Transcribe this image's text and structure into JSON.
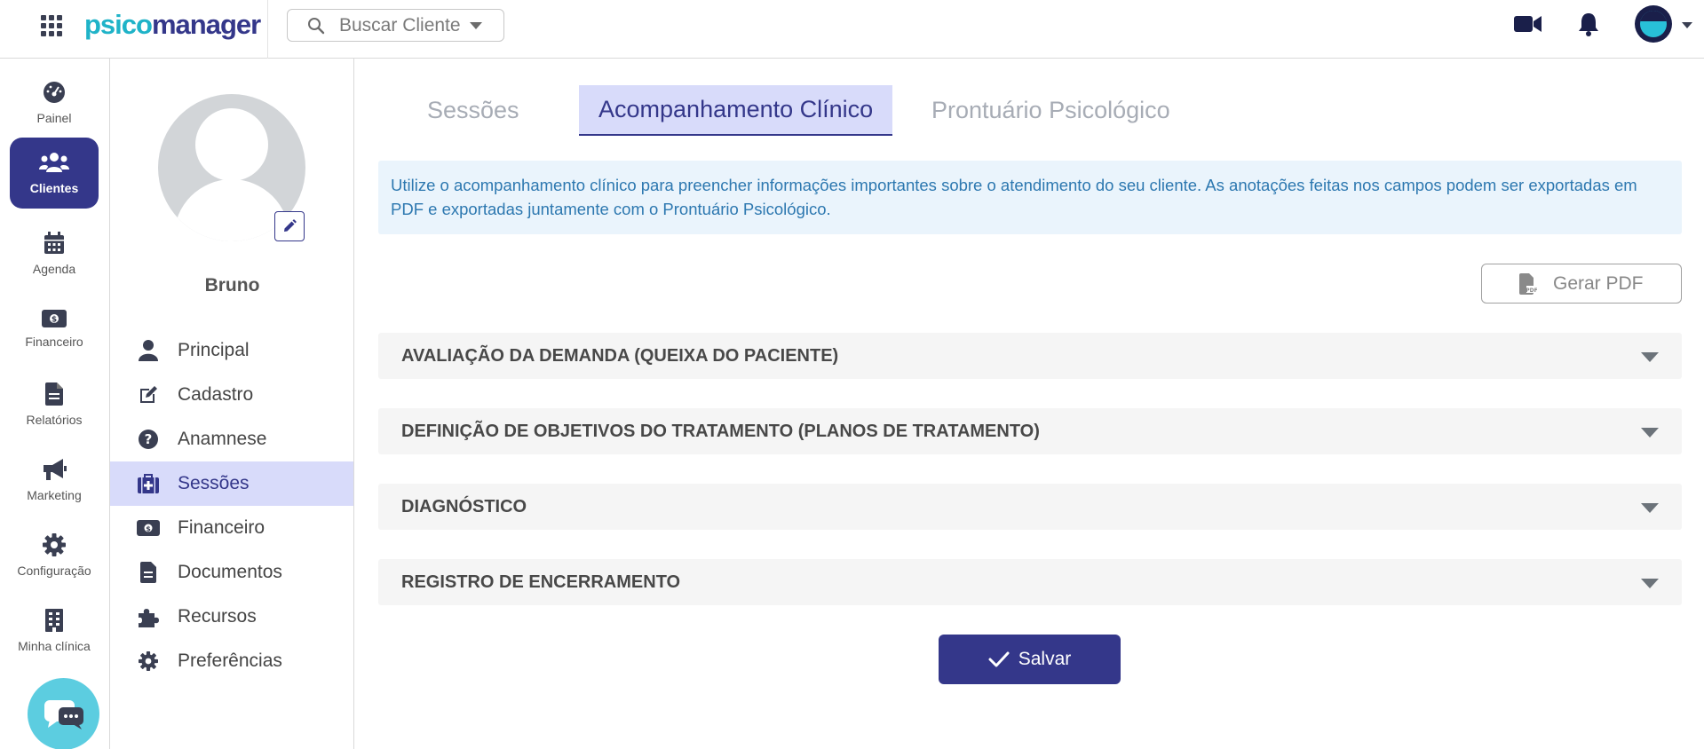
{
  "app": {
    "logo_part1": "psico",
    "logo_part2": "manager"
  },
  "search": {
    "placeholder": "Buscar Cliente"
  },
  "nav": {
    "items": [
      {
        "label": "Painel",
        "icon": "gauge-icon"
      },
      {
        "label": "Clientes",
        "icon": "users-icon",
        "active": true
      },
      {
        "label": "Agenda",
        "icon": "calendar-icon"
      },
      {
        "label": "Financeiro",
        "icon": "money-icon"
      },
      {
        "label": "Relatórios",
        "icon": "document-icon"
      },
      {
        "label": "Marketing",
        "icon": "megaphone-icon"
      },
      {
        "label": "Configuração",
        "icon": "gear-icon"
      },
      {
        "label": "Minha clínica",
        "icon": "building-icon"
      }
    ]
  },
  "client": {
    "name": "Bruno",
    "menu": [
      {
        "label": "Principal",
        "icon": "user-icon"
      },
      {
        "label": "Cadastro",
        "icon": "edit-icon"
      },
      {
        "label": "Anamnese",
        "icon": "question-icon"
      },
      {
        "label": "Sessões",
        "icon": "medkit-icon",
        "active": true
      },
      {
        "label": "Financeiro",
        "icon": "money-icon"
      },
      {
        "label": "Documentos",
        "icon": "document-icon"
      },
      {
        "label": "Recursos",
        "icon": "puzzle-icon"
      },
      {
        "label": "Preferências",
        "icon": "gear-icon"
      }
    ]
  },
  "tabs": [
    {
      "label": "Sessões"
    },
    {
      "label": "Acompanhamento Clínico",
      "active": true
    },
    {
      "label": "Prontuário Psicológico"
    }
  ],
  "info": {
    "text": "Utilize o acompanhamento clínico para preencher informações importantes sobre o atendimento do seu cliente. As anotações feitas nos campos podem ser exportadas em PDF e exportadas juntamente com o Prontuário Psicológico."
  },
  "actions": {
    "pdf_label": "Gerar PDF",
    "save_label": "Salvar"
  },
  "sections": [
    {
      "title": "AVALIAÇÃO DA DEMANDA (QUEIXA DO PACIENTE)"
    },
    {
      "title": "DEFINIÇÃO DE OBJETIVOS DO TRATAMENTO (PLANOS DE TRATAMENTO)"
    },
    {
      "title": "DIAGNÓSTICO"
    },
    {
      "title": "REGISTRO DE ENCERRAMENTO"
    }
  ],
  "colors": {
    "brand": "#34378a",
    "accent": "#1fb3c8",
    "active_bg": "#d8dbfa",
    "info_text": "#2d78b0"
  }
}
